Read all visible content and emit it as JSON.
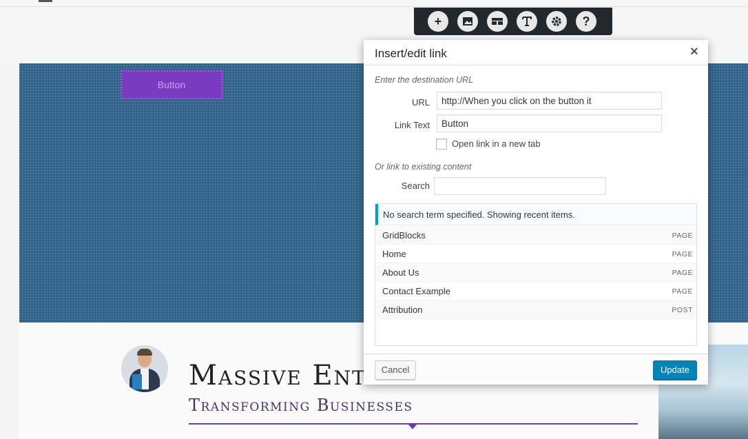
{
  "page": {
    "hero_button_label": "Button",
    "title": "Massive Ent",
    "subtitle": "Transforming Businesses"
  },
  "toolbar": {
    "icons": [
      "plus-icon",
      "image-icon",
      "layout-icon",
      "text-icon",
      "gear-icon",
      "help-icon"
    ],
    "plus_glyph": "+",
    "help_glyph": "?"
  },
  "modal": {
    "title": "Insert/edit link",
    "close_glyph": "×",
    "destination_label": "Enter the destination URL",
    "url_label": "URL",
    "url_value": "http://When you click on the button it",
    "link_text_label": "Link Text",
    "link_text_value": "Button",
    "new_tab_label": "Open link in a new tab",
    "new_tab_checked": false,
    "existing_label": "Or link to existing content",
    "search_label": "Search",
    "search_value": "",
    "notice": "No search term specified. Showing recent items.",
    "results": [
      {
        "title": "GridBlocks",
        "type": "PAGE"
      },
      {
        "title": "Home",
        "type": "PAGE"
      },
      {
        "title": "About Us",
        "type": "PAGE"
      },
      {
        "title": "Contact Example",
        "type": "PAGE"
      },
      {
        "title": "Attribution",
        "type": "POST"
      }
    ],
    "cancel_label": "Cancel",
    "update_label": "Update"
  },
  "colors": {
    "hero_bg": "#2f6289",
    "accent_purple": "#7a3bc1",
    "primary_button": "#0085ba",
    "notice_border": "#00a0d2"
  }
}
